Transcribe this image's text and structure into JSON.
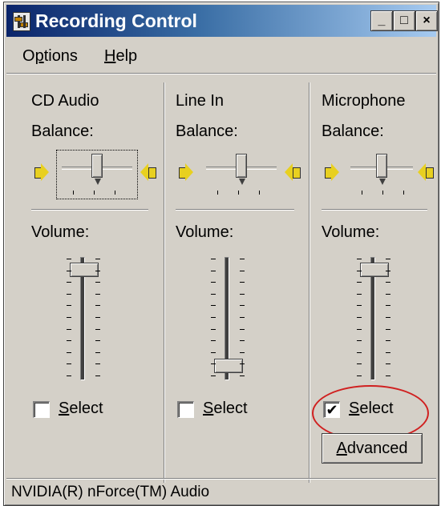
{
  "window": {
    "title": "Recording Control",
    "controls": {
      "minimize": "_",
      "maximize": "□",
      "close": "×"
    }
  },
  "menu": {
    "items": [
      {
        "label": "Options"
      },
      {
        "label": "Help"
      }
    ]
  },
  "channels": [
    {
      "name": "CD Audio",
      "balance_label": "Balance:",
      "balance": 0.5,
      "volume_label": "Volume:",
      "volume": 0.95,
      "select_label": "Select",
      "selected": false,
      "focused": true
    },
    {
      "name": "Line In",
      "balance_label": "Balance:",
      "balance": 0.5,
      "volume_label": "Volume:",
      "volume": 0.05,
      "select_label": "Select",
      "selected": false,
      "focused": false
    },
    {
      "name": "Microphone",
      "balance_label": "Balance:",
      "balance": 0.5,
      "volume_label": "Volume:",
      "volume": 0.95,
      "select_label": "Select",
      "selected": true,
      "focused": false
    }
  ],
  "advanced_button": {
    "label": "Advanced"
  },
  "status": {
    "text": "NVIDIA(R) nForce(TM) Audio"
  },
  "icons": {
    "app": "mixer-icon",
    "speaker_left": "speaker-left-icon",
    "speaker_right": "speaker-right-icon"
  },
  "colors": {
    "titlebar": "#0a246a",
    "face": "#d4d0c8",
    "highlight": "#d02020",
    "speaker": "#e8d020"
  }
}
